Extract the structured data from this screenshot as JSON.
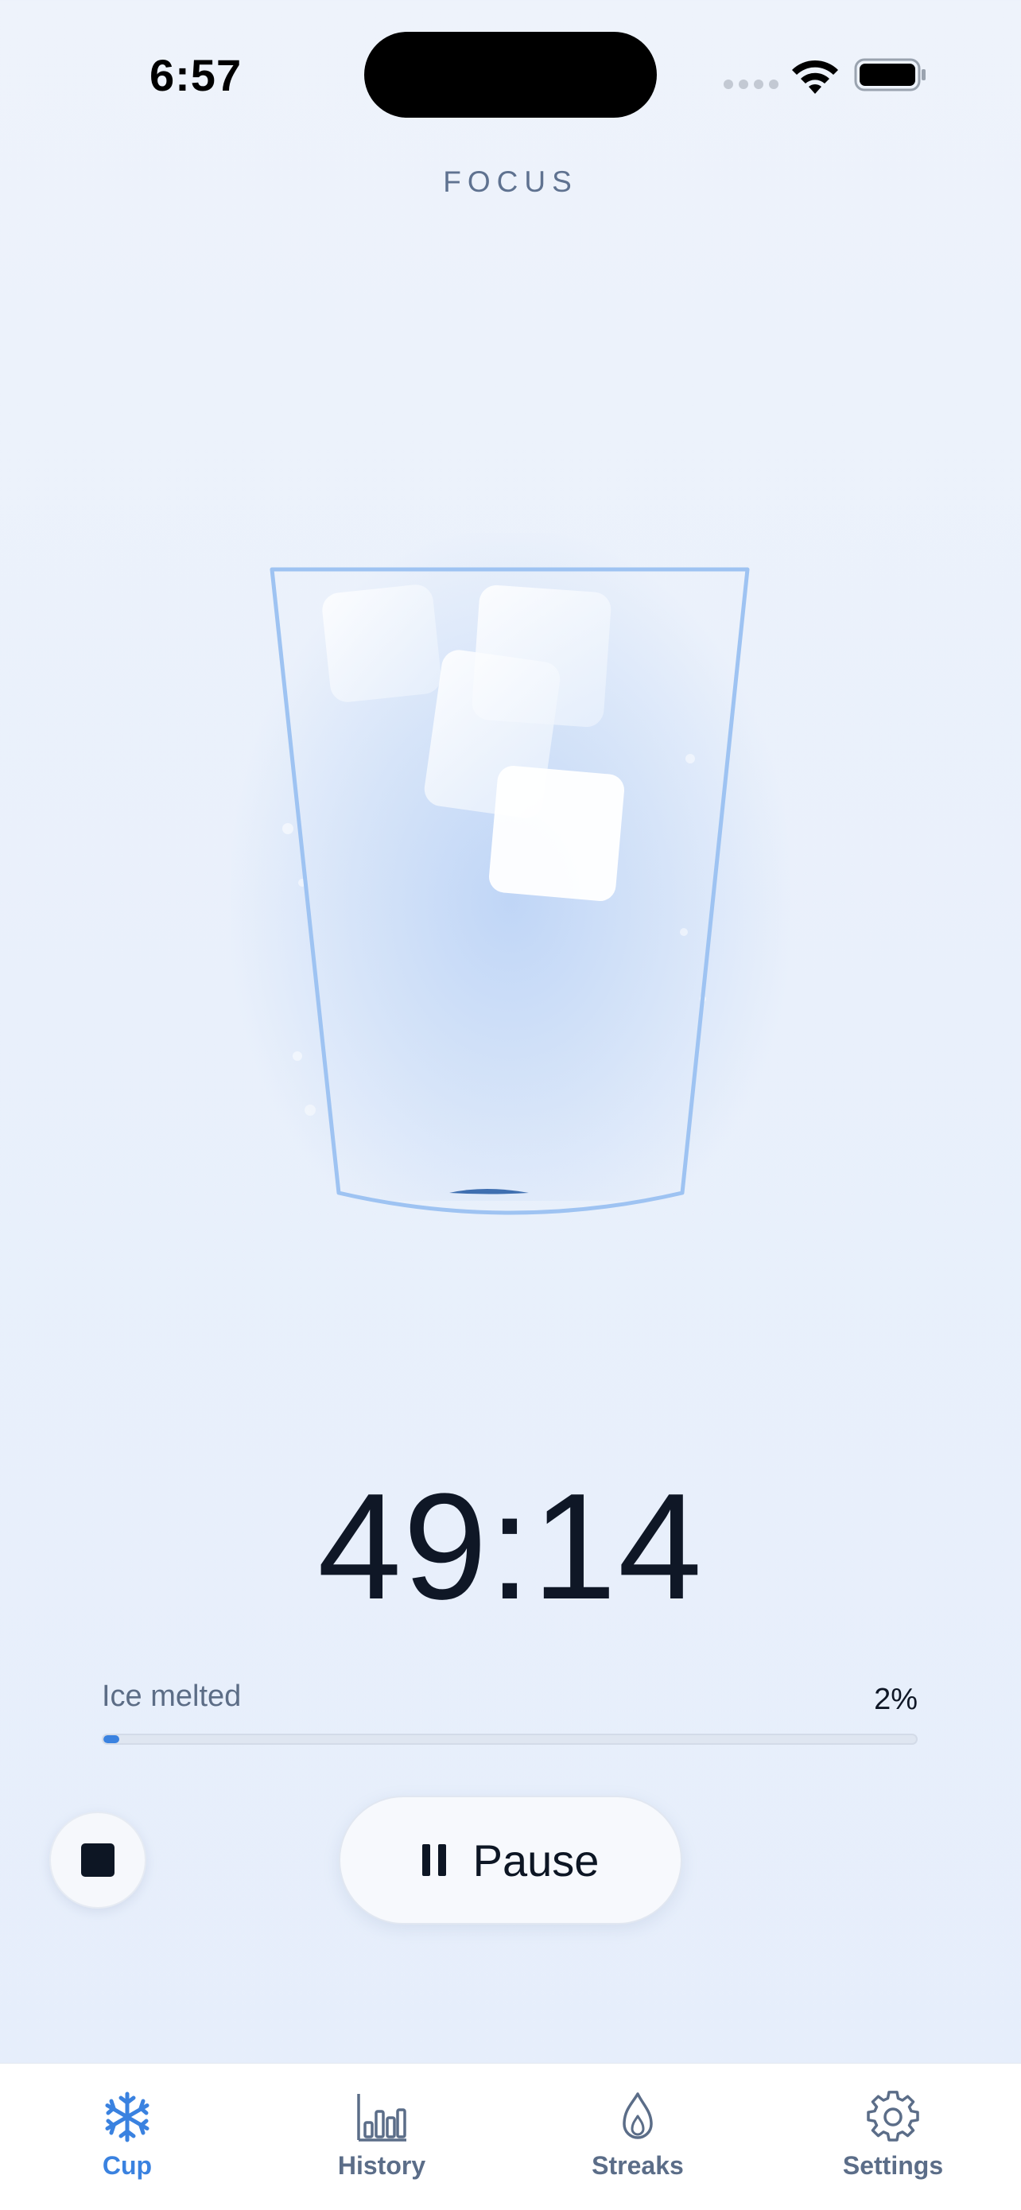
{
  "status_bar": {
    "time": "6:57"
  },
  "header": {
    "mode_label": "FOCUS"
  },
  "cup": {
    "ice_cubes": 4
  },
  "timer": {
    "remaining": "49:14"
  },
  "progress": {
    "label": "Ice melted",
    "percent_text": "2%",
    "fraction": 0.02
  },
  "controls": {
    "pause_label": "Pause",
    "stop_icon": "stop-icon",
    "pause_icon": "pause-icon"
  },
  "tab_bar": {
    "tabs": [
      {
        "label": "Cup",
        "icon": "snowflake-icon",
        "active": true
      },
      {
        "label": "History",
        "icon": "bar-chart-icon",
        "active": false
      },
      {
        "label": "Streaks",
        "icon": "flame-icon",
        "active": false
      },
      {
        "label": "Settings",
        "icon": "gear-icon",
        "active": false
      }
    ]
  },
  "colors": {
    "accent": "#3a82e0",
    "text_primary": "#0f1726",
    "text_secondary": "#5c6d86",
    "cup_outline": "#9ec3f2"
  }
}
